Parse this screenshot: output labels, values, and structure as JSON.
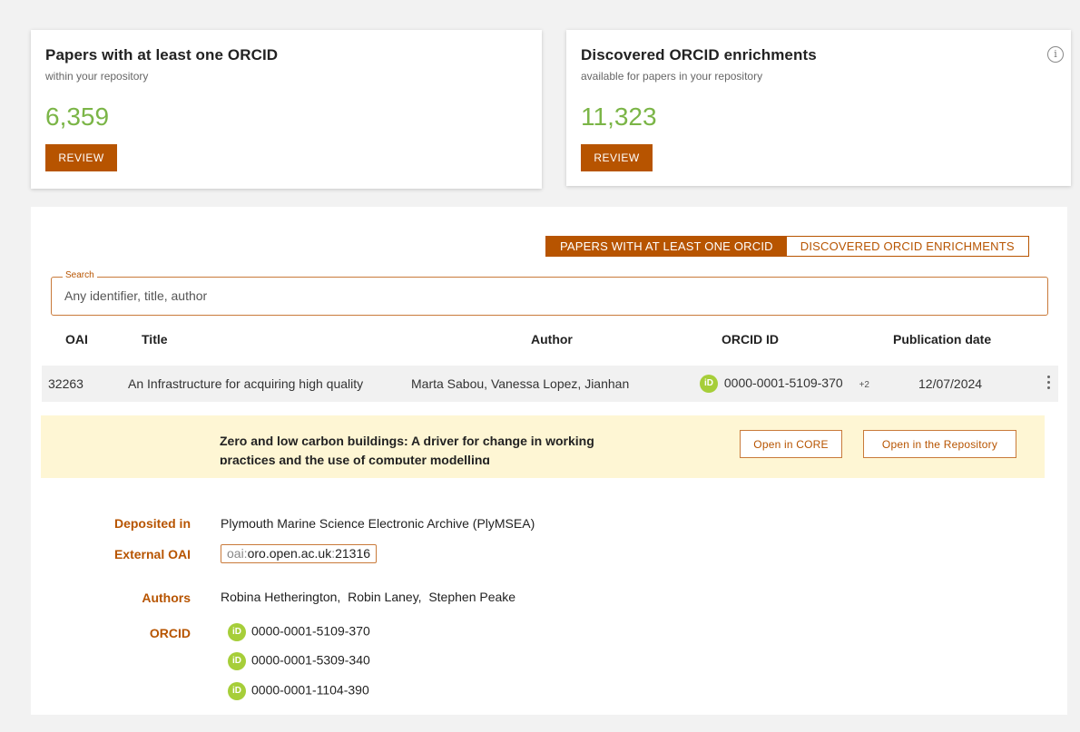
{
  "summary_cards": [
    {
      "title": "Papers with at least one ORCID",
      "subtitle": "within your repository",
      "count": "6,359",
      "button": "REVIEW"
    },
    {
      "title": "Discovered ORCID enrichments",
      "subtitle": "available for papers in your repository",
      "count": "11,323",
      "button": "REVIEW",
      "info_icon": "info-icon"
    }
  ],
  "tabs": [
    {
      "label": "PAPERS WITH AT LEAST ONE ORCID",
      "active": true
    },
    {
      "label": "DISCOVERED ORCID ENRICHMENTS",
      "active": false
    }
  ],
  "search": {
    "legend": "Search",
    "placeholder": "Any identifier, title, author",
    "value": ""
  },
  "table": {
    "columns": [
      "OAI",
      "Title",
      "Author",
      "ORCID ID",
      "Publication date"
    ],
    "rows": [
      {
        "oai": "32263",
        "title": "An Infrastructure for acquiring high quality",
        "author": "Marta Sabou, Vanessa Lopez, Jianhan",
        "orcid": "0000-0001-5109-370",
        "orcid_more": "+2",
        "date": "12/07/2024"
      }
    ]
  },
  "detail": {
    "title": "Zero and low carbon buildings: A driver for change in working practices and the use of computer modelling",
    "open_core_label": "Open in CORE",
    "open_repo_label": "Open in the Repository",
    "deposited_label": "Deposited in",
    "deposited_value": "Plymouth Marine Science Electronic Archive (PlyMSEA)",
    "external_oai_label": "External OAI",
    "external_oai_prefix": "oai:",
    "external_oai_host": "oro.open.ac.uk",
    "external_oai_sep": ":",
    "external_oai_id": "21316",
    "authors_label": "Authors",
    "authors_value": "Robina Hetherington,  Robin Laney,  Stephen Peake",
    "orcid_label": "ORCID",
    "orcids": [
      "0000-0001-5109-370",
      "0000-0001-5309-340",
      "0000-0001-1104-390"
    ]
  },
  "colors": {
    "accent": "#b75400",
    "count_green": "#7bb547",
    "orcid_green": "#a6ce39",
    "highlight": "#fef6d4"
  }
}
